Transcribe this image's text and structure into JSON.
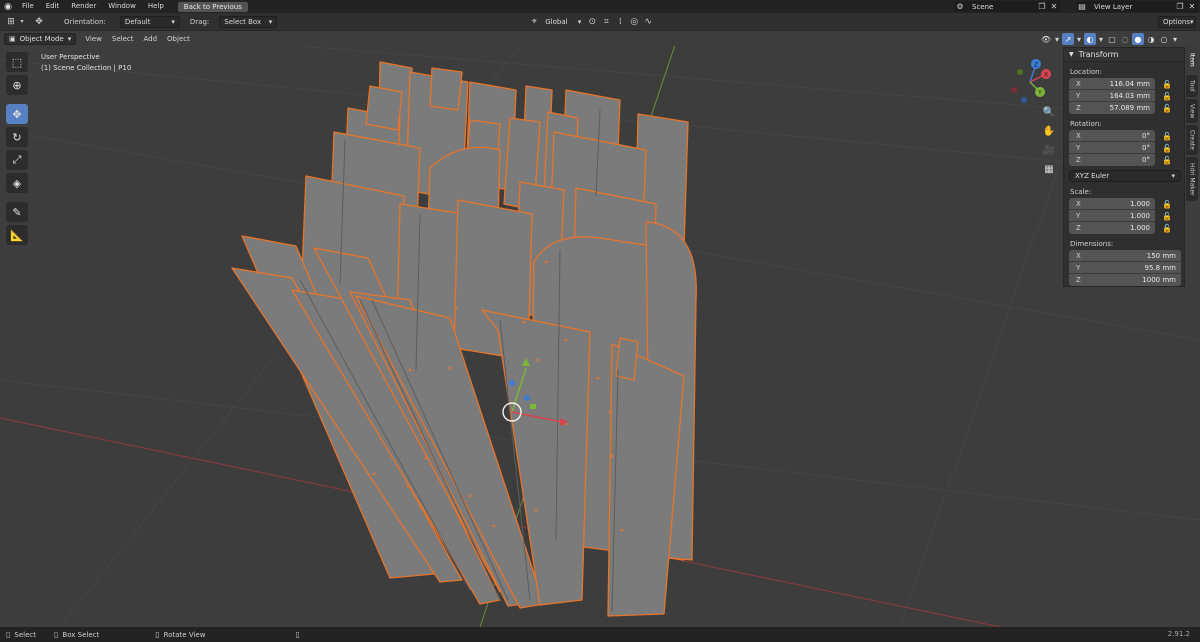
{
  "menubar": {
    "items": [
      "File",
      "Edit",
      "Render",
      "Window",
      "Help"
    ],
    "back_button": "Back to Previous",
    "scene": "Scene",
    "view_layer": "View Layer"
  },
  "tool_header": {
    "orientation_label": "Orientation:",
    "orientation_value": "Default",
    "drag_label": "Drag:",
    "drag_value": "Select Box",
    "transform_orientation": "Global",
    "options": "Options"
  },
  "view_header": {
    "mode": "Object Mode",
    "menus": [
      "View",
      "Select",
      "Add",
      "Object"
    ]
  },
  "viewport": {
    "perspective": "User Perspective",
    "collection": "(1) Scene Collection | P10"
  },
  "npanel": {
    "title": "Transform",
    "location_label": "Location:",
    "location": [
      {
        "axis": "X",
        "value": "116.04 mm"
      },
      {
        "axis": "Y",
        "value": "164.03 mm"
      },
      {
        "axis": "Z",
        "value": "57.089 mm"
      }
    ],
    "rotation_label": "Rotation:",
    "rotation": [
      {
        "axis": "X",
        "value": "0°"
      },
      {
        "axis": "Y",
        "value": "0°"
      },
      {
        "axis": "Z",
        "value": "0°"
      }
    ],
    "rotation_mode": "XYZ Euler",
    "scale_label": "Scale:",
    "scale": [
      {
        "axis": "X",
        "value": "1.000"
      },
      {
        "axis": "Y",
        "value": "1.000"
      },
      {
        "axis": "Z",
        "value": "1.000"
      }
    ],
    "dimensions_label": "Dimensions:",
    "dimensions": [
      {
        "axis": "X",
        "value": "150 mm"
      },
      {
        "axis": "Y",
        "value": "95.8 mm"
      },
      {
        "axis": "Z",
        "value": "1000 mm"
      }
    ]
  },
  "side_tabs": [
    "Item",
    "Tool",
    "View",
    "Create",
    "Hdri Maker"
  ],
  "gizmo": {
    "x": "X",
    "y": "Y",
    "z": "Z"
  },
  "statusbar": {
    "select": "Select",
    "box_select": "Box Select",
    "rotate_view": "Rotate View",
    "version": "2.91.2"
  },
  "colors": {
    "accent": "#5680c2",
    "outline": "#e8742a",
    "x_axis": "#d9434f",
    "y_axis": "#7eb63a",
    "z_axis": "#3e7dd6"
  }
}
